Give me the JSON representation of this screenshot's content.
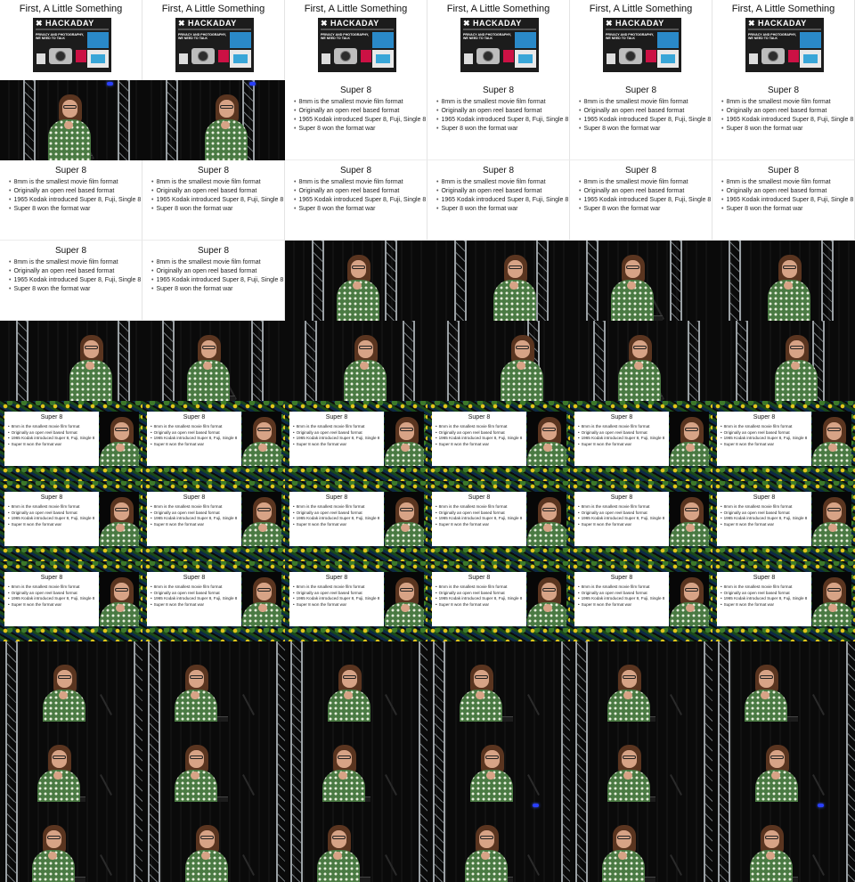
{
  "title_slide": {
    "heading": "First, A Little Something",
    "brand": "HACKADAY",
    "headline": "PRIVACY AND PHOTOGRAPHY, WE NEED TO TALK"
  },
  "super8_slide": {
    "title": "Super 8",
    "bullets": [
      "8mm is the smallest movie film format",
      "Originally an open reel based format",
      "1965 Kodak introduced Super 8, Fuji, Single 8",
      "Super 8 won the format war"
    ]
  },
  "grid": {
    "columns": 6,
    "rows": 11,
    "tiles": [
      "title",
      "title",
      "title",
      "title",
      "title",
      "title",
      "stage",
      "stage",
      "slide",
      "slide",
      "slide",
      "slide",
      "slide",
      "slide",
      "slide",
      "slide",
      "slide",
      "slide",
      "slide",
      "slide",
      "stage",
      "stage",
      "stage",
      "stage",
      "stage",
      "stage",
      "stage",
      "stage",
      "stage",
      "stage",
      "combo",
      "combo",
      "combo",
      "combo",
      "combo",
      "combo",
      "combo",
      "combo",
      "combo",
      "combo",
      "combo",
      "combo",
      "combo",
      "combo",
      "combo",
      "combo",
      "combo",
      "combo",
      "stage",
      "stage",
      "stage",
      "stage",
      "stage",
      "stage",
      "stage",
      "stage",
      "stage",
      "stage",
      "stage",
      "stage",
      "stage",
      "stage",
      "stage",
      "stage",
      "stage",
      "stage"
    ]
  },
  "colors": {
    "stage_background": "#050505",
    "dress_green": "#4a7a43",
    "truss_grey": "#9aa0a4",
    "hackaday_dark": "#1c1c1c",
    "hackaday_blue": "#2a89c8"
  }
}
